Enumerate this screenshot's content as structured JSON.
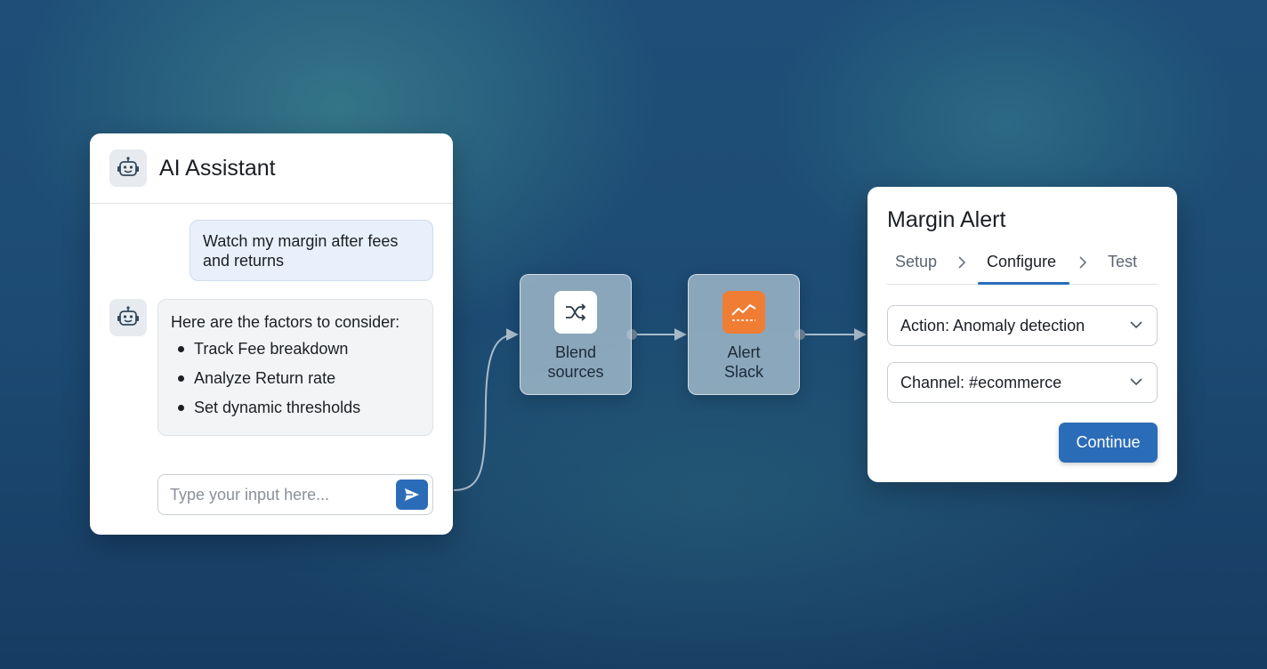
{
  "chat": {
    "title": "AI Assistant",
    "user_message": "Watch my margin after fees and returns",
    "assistant_intro": "Here are the factors to consider:",
    "assistant_items": [
      "Track Fee breakdown",
      "Analyze Return rate",
      "Set dynamic thresholds"
    ],
    "input_placeholder": "Type your input here...",
    "avatar_icon": "robot-icon",
    "send_icon": "send-icon"
  },
  "flow": {
    "nodes": [
      {
        "label_line1": "Blend",
        "label_line2": "sources",
        "icon": "shuffle-icon",
        "icon_bg": "#ffffff"
      },
      {
        "label_line1": "Alert",
        "label_line2": "Slack",
        "icon": "trend-chart-icon",
        "icon_bg": "#ef7d34"
      }
    ]
  },
  "alert": {
    "title": "Margin Alert",
    "steps": [
      "Setup",
      "Configure",
      "Test"
    ],
    "active_step": "Configure",
    "action_select": "Action: Anomaly detection",
    "channel_select": "Channel: #ecommerce",
    "continue_label": "Continue"
  },
  "colors": {
    "accent": "#2b6cb8",
    "alert_orange": "#ef7d34"
  }
}
